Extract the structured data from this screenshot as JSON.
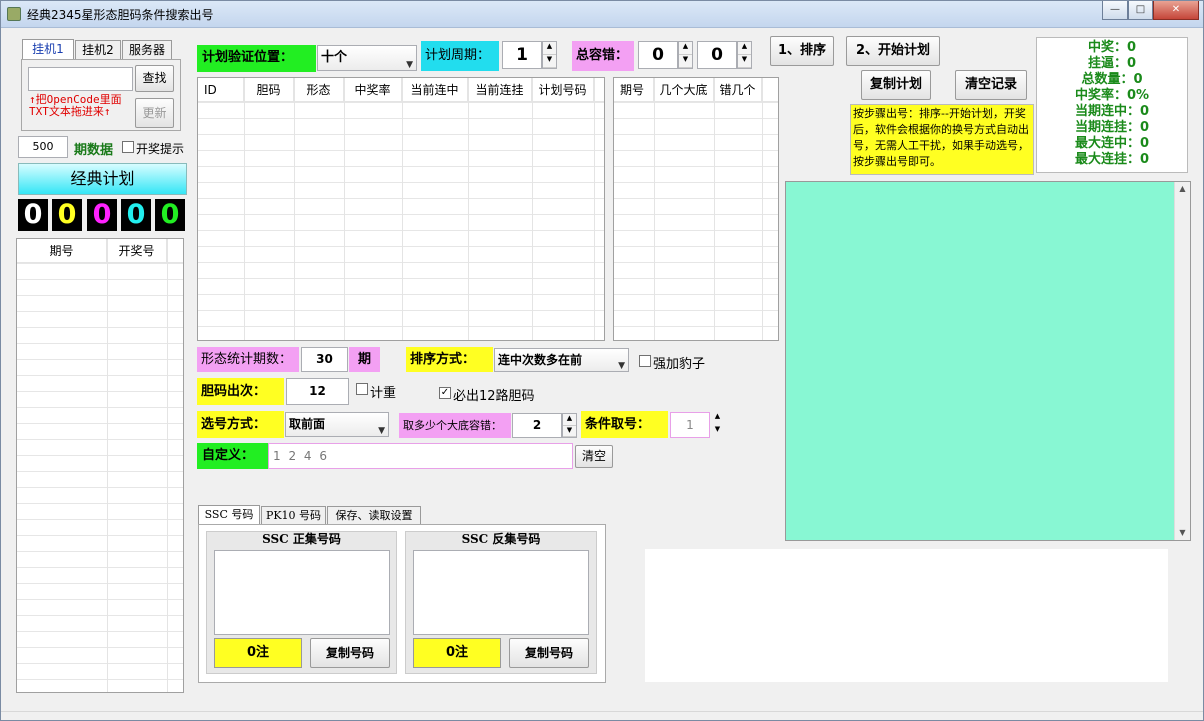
{
  "window": {
    "title": "经典2345星形态胆码条件搜索出号",
    "min": "—",
    "max": "□",
    "close": "✕"
  },
  "left": {
    "tabs": [
      "挂机1",
      "挂机2",
      "服务器"
    ],
    "search_btn": "查找",
    "update_btn": "更新",
    "hint_line1": "↑把OpenCode里面",
    "hint_line2": "TXT文本拖进来↑",
    "periods_value": "500",
    "periods_label": "期数据",
    "notify_label": "开奖提示",
    "classic_plan": "经典计划",
    "digits": [
      "0",
      "0",
      "0",
      "0",
      "0"
    ],
    "table_headers": [
      "期号",
      "开奖号"
    ]
  },
  "top": {
    "verify_label": "计划验证位置：",
    "verify_value": "十个",
    "cycle_label": "计划周期：",
    "cycle_value": "1",
    "tolerance_label": "总容错：",
    "tol_value1": "0",
    "tol_value2": "0",
    "sort_btn": "1、排序",
    "start_btn": "2、开始计划",
    "copy_plan_btn": "复制计划",
    "clear_btn": "清空记录"
  },
  "plan_table": {
    "headers": [
      "ID",
      "胆码",
      "形态",
      "中奖率",
      "当前连中",
      "当前连挂",
      "计划号码"
    ]
  },
  "miss_table": {
    "headers": [
      "期号",
      "几个大底",
      "错几个"
    ]
  },
  "instructions": "按步骤出号：排序--开始计划，开奖后，软件会根据你的换号方式自动出号，无需人工干扰，如果手动选号，按步骤出号即可。",
  "stats": [
    {
      "label": "中奖：",
      "value": "0"
    },
    {
      "label": "挂逼：",
      "value": "0"
    },
    {
      "label": "总数量：",
      "value": "0"
    },
    {
      "label": "中奖率：",
      "value": "0%"
    },
    {
      "label": "当期连中：",
      "value": "0"
    },
    {
      "label": "当期连挂：",
      "value": "0"
    },
    {
      "label": "最大连中：",
      "value": "0"
    },
    {
      "label": "最大连挂：",
      "value": "0"
    }
  ],
  "settings": {
    "form_stats_label": "形态统计期数：",
    "form_stats_value": "30",
    "period_unit": "期",
    "sort_label": "排序方式：",
    "sort_value": "连中次数多在前",
    "leopard_label": "强加豹子",
    "dan_count_label": "胆码出次：",
    "dan_count_value": "12",
    "recount_label": "计重",
    "must12_label": "必出12路胆码",
    "select_label": "选号方式：",
    "select_value": "取前面",
    "tol_base_label": "取多少个大底容错：",
    "tol_base_value": "2",
    "cond_label": "条件取号：",
    "cond_value": "1",
    "custom_label": "自定义：",
    "custom_value": "1 2 4 6",
    "custom_clear": "清空"
  },
  "bottom_tabs": [
    "SSC 号码",
    "PK10 号码",
    "保存、读取设置"
  ],
  "ssc": {
    "positive_title": "SSC 正集号码",
    "negative_title": "SSC 反集号码",
    "positive_count": "0注",
    "negative_count": "0注",
    "copy_btn": "复制号码"
  },
  "colors": {
    "green_output": "#88f7d3",
    "yellow": "#ffff22",
    "pink": "#f3a0f3",
    "cyan": "#22ddee",
    "green": "#22ee22"
  }
}
